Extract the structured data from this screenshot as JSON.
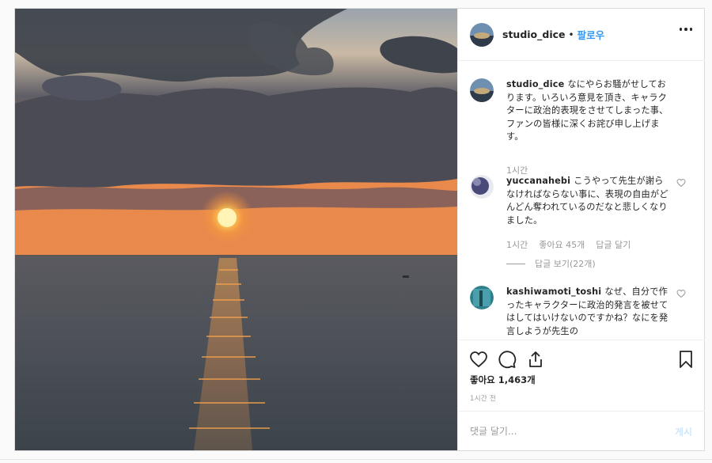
{
  "header": {
    "username": "studio_dice",
    "separator": "•",
    "follow_label": "팔로우"
  },
  "comments": [
    {
      "username": "studio_dice",
      "text": "なにやらお騒がせしております。いろいろ意見を頂き、キャラクターに政治的表現をさせてしまった事、ファンの皆様に深くお詫び申し上げます。",
      "time": "1시간"
    },
    {
      "username": "yuccanahebi",
      "text": "こうやって先生が謝らなければならない事に、表現の自由がどんどん奪われているのだなと悲しくなりました。",
      "time": "1시간",
      "likes": "좋아요 45개",
      "reply_label": "답글 달기",
      "view_replies": "답글 보기(22개)"
    },
    {
      "username": "kashiwamoti_toshi",
      "text": "なぜ、自分で作ったキャラクターに政治的発言を被せてはしてはいけないのですかね？なにを発言しようが先生の"
    }
  ],
  "likes_count": "좋아요 1,463개",
  "timestamp": "1시간 전",
  "add_comment": {
    "placeholder": "댓글 달기...",
    "post_label": "게시"
  },
  "icons": {
    "like": "heart-icon",
    "comment": "comment-icon",
    "share": "share-icon",
    "save": "bookmark-icon",
    "more": "more-options-icon"
  },
  "colors": {
    "link": "#3897f0",
    "muted": "#999999",
    "post_disabled": "#b3dbff",
    "border": "#dbdbdb"
  }
}
